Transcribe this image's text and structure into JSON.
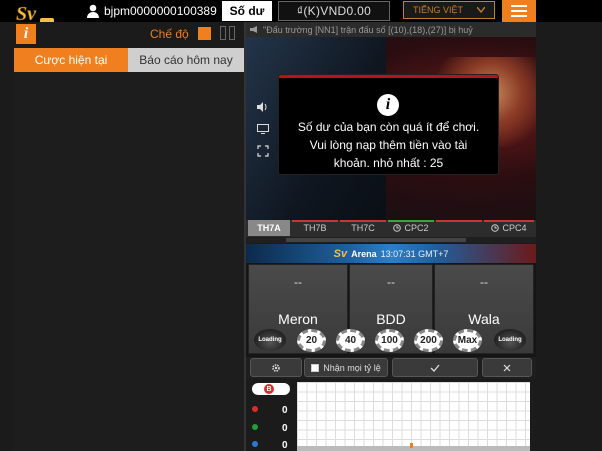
{
  "topbar": {
    "username": "bjpm0000000100389",
    "balance_button": "Số dư",
    "balance_value": "₫(K)VND0.00",
    "language": "TIẾNG VIỆT"
  },
  "left_panel": {
    "mode_label": "Chế độ",
    "tabs": [
      "Cược hiện tại",
      "Báo cáo hôm nay"
    ]
  },
  "marquee": "\"Đấu trường [NN1] trận đấu số [(10),(18),(27)] bị huỷ",
  "modal": {
    "lines": [
      "Số dư của bạn còn quá ít để chơi.",
      "Vui lòng nạp thêm tiền vào tài",
      "khoản. nhỏ nhất : 25"
    ]
  },
  "tables": [
    "TH7A",
    "TH7B",
    "TH7C",
    "CPC2",
    "CPC4"
  ],
  "tables_active": "TH7A",
  "arena": {
    "name": "Arena",
    "time": "13:07:31 GMT+7"
  },
  "bets": [
    {
      "label": "Meron",
      "value": "--"
    },
    {
      "label": "BDD",
      "value": "--"
    },
    {
      "label": "Wala",
      "value": "--"
    }
  ],
  "loading_label": "Loading",
  "chips": [
    "20",
    "40",
    "100",
    "200",
    "Max"
  ],
  "actions": {
    "accept_odds_label": "Nhận mọi tỷ lệ"
  },
  "stats": {
    "badge": "B",
    "counts": [
      "0",
      "0",
      "0"
    ]
  },
  "colors": {
    "accent": "#f07f1f",
    "red": "#d82e2e",
    "green": "#1f9e3a",
    "blue": "#2a78d2"
  }
}
